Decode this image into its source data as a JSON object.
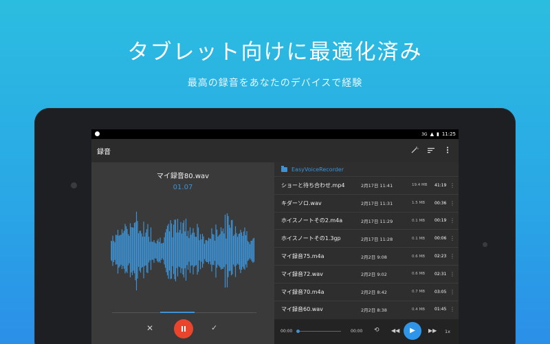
{
  "promo": {
    "headline": "タブレット向けに最適化済み",
    "subline": "最高の録音をあなたのデバイスで経験"
  },
  "status_bar": {
    "signal_label": "3G",
    "time": "11:25"
  },
  "app_bar": {
    "title": "録音",
    "actions": [
      "magic-wand-icon",
      "sort-icon",
      "more-vert-icon"
    ]
  },
  "recorder": {
    "file_name": "マイ録音80.wav",
    "elapsed": "01.07",
    "controls": [
      "cancel-icon",
      "pause-icon",
      "check-icon"
    ],
    "accent_color": "#3d93d6",
    "record_color": "#e8452c"
  },
  "file_list": {
    "folder": "EasyVoiceRecorder",
    "items": [
      {
        "name": "ショーと待ち合わせ.mp4",
        "date": "2月17日 11:41",
        "size": "19.4 MB",
        "duration": "41:19"
      },
      {
        "name": "キダーソロ.wav",
        "date": "2月17日 11:31",
        "size": "1.5 MB",
        "duration": "00:36"
      },
      {
        "name": "ホイスノートその2.m4a",
        "date": "2月17日 11:29",
        "size": "0.1 MB",
        "duration": "00:19"
      },
      {
        "name": "ホイスノートその1.3gp",
        "date": "2月17日 11:28",
        "size": "0.1 MB",
        "duration": "00:06"
      },
      {
        "name": "マイ録音75.m4a",
        "date": "2月2日 9:08",
        "size": "0.6 MB",
        "duration": "02:23"
      },
      {
        "name": "マイ録音72.wav",
        "date": "2月2日 9:02",
        "size": "0.6 MB",
        "duration": "02:31"
      },
      {
        "name": "マイ録音70.m4a",
        "date": "2月2日 8:42",
        "size": "0.7 MB",
        "duration": "03:05"
      },
      {
        "name": "マイ録音60.wav",
        "date": "2月2日 8:38",
        "size": "0.4 MB",
        "duration": "01:45"
      }
    ]
  },
  "player": {
    "current": "00:00",
    "end": "00:00",
    "speed": "1x",
    "progress": 0
  }
}
